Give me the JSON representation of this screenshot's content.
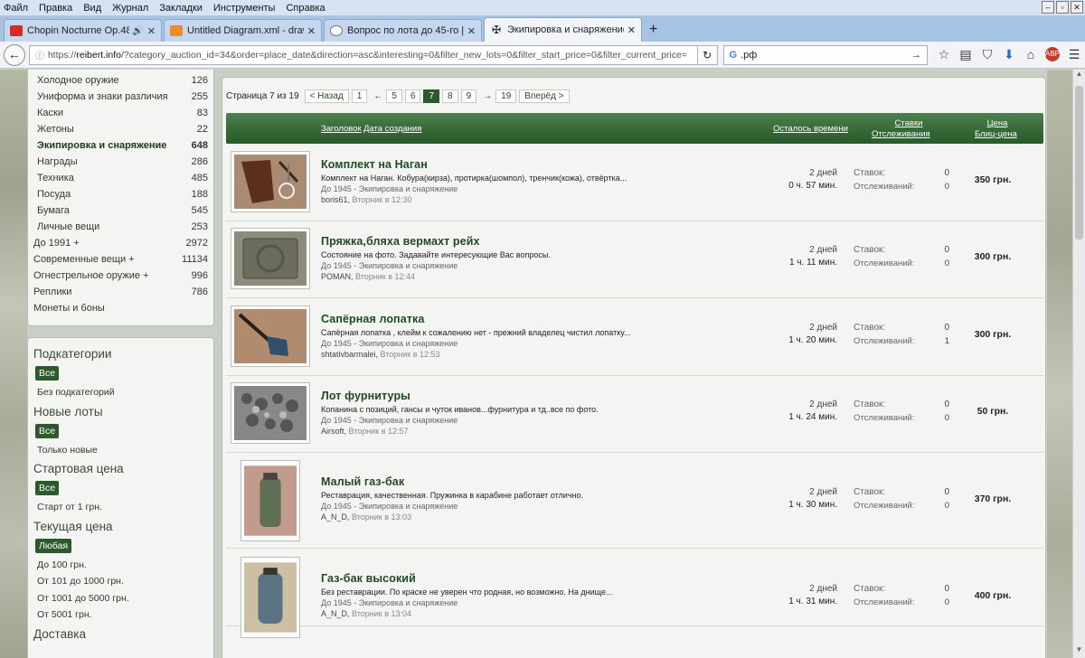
{
  "menu": [
    "Файл",
    "Правка",
    "Вид",
    "Журнал",
    "Закладки",
    "Инструменты",
    "Справка"
  ],
  "tabs": [
    {
      "label": "Chopin Nocturne Op.48 N...",
      "favicon_color": "#d62b1f",
      "audio": true
    },
    {
      "label": "Untitled Diagram.xml - draw.io",
      "favicon_color": "#f08a24",
      "audio": false
    },
    {
      "label": "Вопрос по лота до 45-го | R...",
      "favicon_color": "#777777",
      "audio": false
    },
    {
      "label": "Экипировка и снаряжение |...",
      "favicon_color": "#333333",
      "audio": false
    }
  ],
  "address": {
    "prefix": "https://",
    "host": "reibert.info",
    "path": "/?category_auction_id=34&order=place_date&direction=asc&interesting=0&filter_new_lots=0&filter_start_price=0&filter_current_price=",
    "search_text": ".рф"
  },
  "categories": [
    {
      "name": "Холодное оружие",
      "count": "126",
      "sub": true
    },
    {
      "name": "Униформа и знаки различия",
      "count": "255",
      "sub": true
    },
    {
      "name": "Каски",
      "count": "83",
      "sub": true
    },
    {
      "name": "Жетоны",
      "count": "22",
      "sub": true
    },
    {
      "name": "Экипировка и снаряжение",
      "count": "648",
      "sub": true,
      "active": true
    },
    {
      "name": "Награды",
      "count": "286",
      "sub": true
    },
    {
      "name": "Техника",
      "count": "485",
      "sub": true
    },
    {
      "name": "Посуда",
      "count": "188",
      "sub": true
    },
    {
      "name": "Бумага",
      "count": "545",
      "sub": true
    },
    {
      "name": "Личные вещи",
      "count": "253",
      "sub": true
    },
    {
      "name": "До 1991 +",
      "count": "2972",
      "sub": false
    },
    {
      "name": "Современные вещи +",
      "count": "11134",
      "sub": false
    },
    {
      "name": "Огнестрельное оружие +",
      "count": "996",
      "sub": false
    },
    {
      "name": "Реплики",
      "count": "786",
      "sub": false
    },
    {
      "name": "Монеты и боны",
      "count": "",
      "sub": false
    }
  ],
  "filters": {
    "subcat": {
      "title": "Подкатегории",
      "selected": "Все",
      "option": "Без подкатегорий"
    },
    "newlots": {
      "title": "Новые лоты",
      "selected": "Все",
      "option": "Только новые"
    },
    "start": {
      "title": "Стартовая цена",
      "selected": "Все",
      "option": "Старт от 1 грн."
    },
    "current": {
      "title": "Текущая цена",
      "selected": "Любая",
      "options": [
        "До 100 грн.",
        "От 101 до 1000 грн.",
        "От 1001 до 5000 грн.",
        "От 5001 грн."
      ]
    },
    "delivery": {
      "title": "Доставка"
    }
  },
  "pager": {
    "label": "Страница 7 из 19",
    "prev": "< Назад",
    "next": "Вперёд >",
    "pages": [
      "1",
      "←",
      "5",
      "6",
      "7",
      "8",
      "9",
      "→",
      "19"
    ],
    "current": "7"
  },
  "table_head": {
    "title": "Заголовок",
    "date": "Дата создания",
    "time": "Осталось времени",
    "bids": "Ставки",
    "watch": "Отслеживания",
    "price": "Цена",
    "blitz": "Блиц-цена"
  },
  "labels": {
    "bids": "Ставок:",
    "watch": "Отслеживаний:"
  },
  "lots": [
    {
      "title": "Комплект на Наган",
      "desc": "Комплект на Наган. Кобура(кирза), протирка(шомпол), тренчик(кожа), отвёртка...",
      "cat": "До 1945 - Экипировка и снаряжение",
      "user": "boris61",
      "when": "Вторник в 12:30",
      "time1": "2 дней",
      "time2": "0 ч. 57 мин.",
      "bids": "0",
      "watch": "0",
      "price": "350 грн.",
      "thumb": "holster"
    },
    {
      "title": "Пряжка,бляха вермахт рейх",
      "desc": "Состояние на фото. Задавайте интересующие Вас вопросы.",
      "cat": "До 1945 - Экипировка и снаряжение",
      "user": "POMAN",
      "when": "Вторник в 12:44",
      "time1": "2 дней",
      "time2": "1 ч. 11 мин.",
      "bids": "0",
      "watch": "0",
      "price": "300 грн.",
      "thumb": "buckle"
    },
    {
      "title": "Сапёрная лопатка",
      "desc": "Сапёрная лопатка , клейм к сожалению нет - прежний владелец чистил лопатку...",
      "cat": "До 1945 - Экипировка и снаряжение",
      "user": "shtativbarmalei",
      "when": "Вторник в 12:53",
      "time1": "2 дней",
      "time2": "1 ч. 20 мин.",
      "bids": "0",
      "watch": "1",
      "price": "300 грн.",
      "thumb": "shovel"
    },
    {
      "title": "Лот фурнитуры",
      "desc": "Копанина с позиций, гансы и чуток иванов...фурнитура и тд..все по фото.",
      "cat": "До 1945 - Экипировка и снаряжение",
      "user": "Airsoft",
      "when": "Вторник в 12:57",
      "time1": "2 дней",
      "time2": "1 ч. 24 мин.",
      "bids": "0",
      "watch": "0",
      "price": "50 грн.",
      "thumb": "parts"
    },
    {
      "title": "Малый газ-бак",
      "desc": "Реставрация, качественная. Пружинка в карабине работает отлично.",
      "cat": "До 1945 - Экипировка и снаряжение",
      "user": "A_N_D",
      "when": "Вторник в 13:03",
      "time1": "2 дней",
      "time2": "1 ч. 30 мин.",
      "bids": "0",
      "watch": "0",
      "price": "370 грн.",
      "thumb": "gascan"
    },
    {
      "title": "Газ-бак высокий",
      "desc": "Без реставрации. По краске не уверен что родная, но возможно. На днище...",
      "cat": "До 1945 - Экипировка и снаряжение",
      "user": "A_N_D",
      "when": "Вторник в 13:04",
      "time1": "2 дней",
      "time2": "1 ч. 31 мин.",
      "bids": "0",
      "watch": "0",
      "price": "400 грн.",
      "thumb": "gascan2"
    }
  ]
}
